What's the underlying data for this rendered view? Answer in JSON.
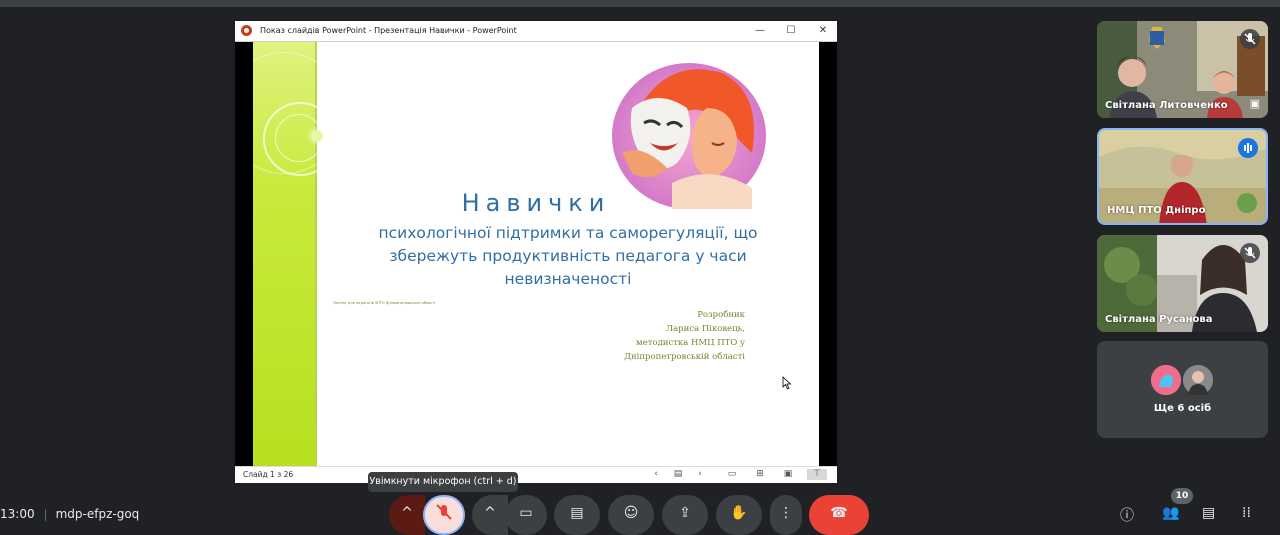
{
  "window": {
    "title": "Показ слайдів PowerPoint  -  Презентація Навички - PowerPoint",
    "minimize": "—",
    "maximize": "☐",
    "close": "✕"
  },
  "slide": {
    "heading": "Навички",
    "subtitle": "психологічної підтримки та саморегуляції, що збережуть продуктивність педагога у часи невизначеності",
    "small_text": "Тренінг для педагогів ЗПТО Дніпропетровської області",
    "author": [
      "Розробник",
      "Лариса Піковець,",
      "методистка НМЦ ПТО у",
      "Дніпропетровській області"
    ]
  },
  "status_bar": {
    "slide_count": "Слайд 1 з 26",
    "prev": "‹",
    "next": "›"
  },
  "participants": [
    {
      "name": "Світлана Литовченко"
    },
    {
      "name": "НМЦ ПТО Дніпро"
    },
    {
      "name": "Світлана Русанова"
    }
  ],
  "more_participants": "Ще 6 осіб",
  "tooltip": "Увімкнути мікрофон (ctrl + d)",
  "meeting": {
    "time": "13:00",
    "code": "mdp-efpz-goq"
  },
  "participant_count": "10",
  "colors": {
    "accent_red": "#ea4335",
    "lime": "#c8ea3c",
    "slide_blue": "#2f6fa6"
  }
}
